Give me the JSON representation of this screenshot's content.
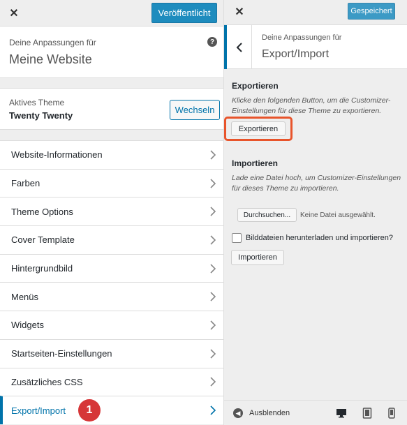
{
  "left": {
    "close_label": "✕",
    "publish_label": "Veröffentlicht",
    "info": {
      "subtitle": "Deine Anpassungen für",
      "title": "Meine Website",
      "help": "?"
    },
    "theme": {
      "label": "Aktives Theme",
      "name": "Twenty Twenty",
      "change_label": "Wechseln"
    },
    "menu_items": [
      {
        "label": "Website-Informationen"
      },
      {
        "label": "Farben"
      },
      {
        "label": "Theme Options"
      },
      {
        "label": "Cover Template"
      },
      {
        "label": "Hintergrundbild"
      },
      {
        "label": "Menüs"
      },
      {
        "label": "Widgets"
      },
      {
        "label": "Startseiten-Einstellungen"
      },
      {
        "label": "Zusätzliches CSS"
      },
      {
        "label": "Export/Import"
      }
    ],
    "step_badge": "1"
  },
  "right": {
    "close_label": "✕",
    "saved_label": "Gespeichert",
    "header": {
      "subtitle": "Deine Anpassungen für",
      "title": "Export/Import"
    },
    "export": {
      "title": "Exportieren",
      "description": "Klicke den folgenden Button, um die Customizer-Einstellungen für diese Theme zu exportieren.",
      "button": "Exportieren"
    },
    "import": {
      "title": "Importieren",
      "description": "Lade eine Datei hoch, um Customizer-Einstellungen für dieses Theme zu importieren.",
      "browse_button": "Durchsuchen...",
      "no_file": "Keine Datei ausgewählt.",
      "checkbox_label": "Bilddateien herunterladen und importieren?",
      "button": "Importieren"
    },
    "footer": {
      "collapse_label": "Ausblenden"
    }
  },
  "colors": {
    "accent": "#0073aa",
    "primary_button": "#1e8cbe",
    "highlight": "#e8542b",
    "badge": "#d63638"
  }
}
